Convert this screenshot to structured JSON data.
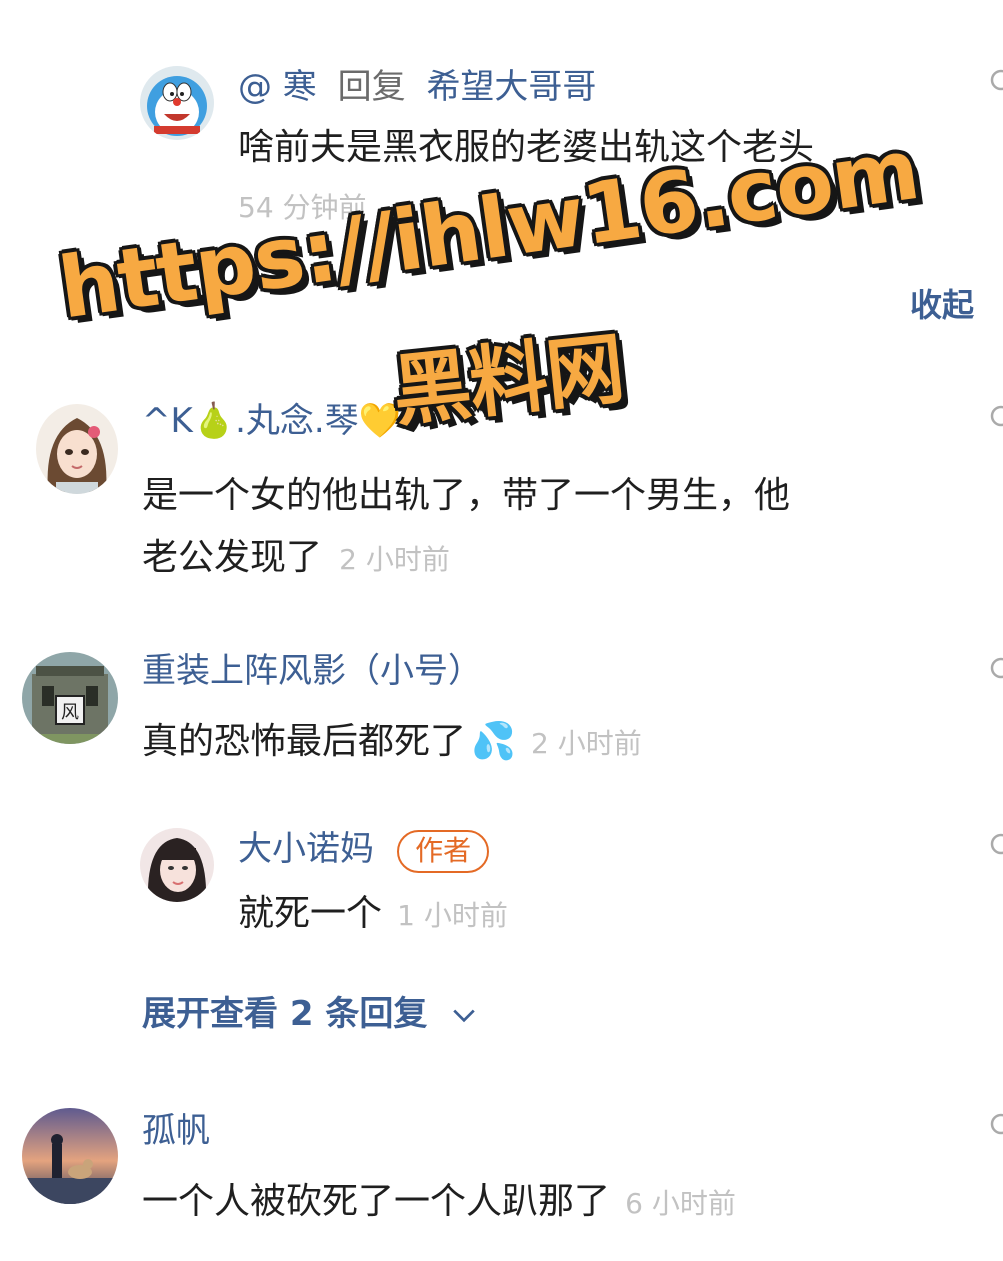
{
  "comments": [
    {
      "author": "@ 寒",
      "reply_word": "回复",
      "reply_to": "希望大哥哥",
      "content": "啥前夫是黑衣服的老婆出轨这个老头",
      "time": "54 分钟前",
      "avatar_icon": "doraemon-avatar"
    },
    {
      "author": "^K🍐.丸念.琴💛",
      "content_line1": "是一个女的他出轨了，带了一个男生，他",
      "content_line2": "老公发现了",
      "time": "2 小时前",
      "avatar_icon": "anime-girl-avatar"
    },
    {
      "author": "重装上阵风影（小号）",
      "content": "真的恐怖最后都死了",
      "content_emoji": "💦",
      "time": "2 小时前",
      "avatar_icon": "game-building-avatar"
    },
    {
      "author": "大小诺妈",
      "badge": "作者",
      "content": "就死一个",
      "time": "1 小时前",
      "avatar_icon": "girl-photo-avatar"
    },
    {
      "author": "孤帆",
      "content": "一个人被砍死了一个人趴那了",
      "time": "6 小时前",
      "avatar_icon": "sunset-dog-avatar"
    }
  ],
  "collapse_label": "收起",
  "expand_label": "展开查看 2 条回复",
  "expand_icon": "chevron-down-icon",
  "watermark": {
    "url": "https://ihlw16.com",
    "site": "黑料网"
  },
  "colors": {
    "name": "#3d5f93",
    "content": "#1f1f1f",
    "time": "#c2c2c2",
    "badge": "#e46a25",
    "watermark": "#f7a942"
  }
}
